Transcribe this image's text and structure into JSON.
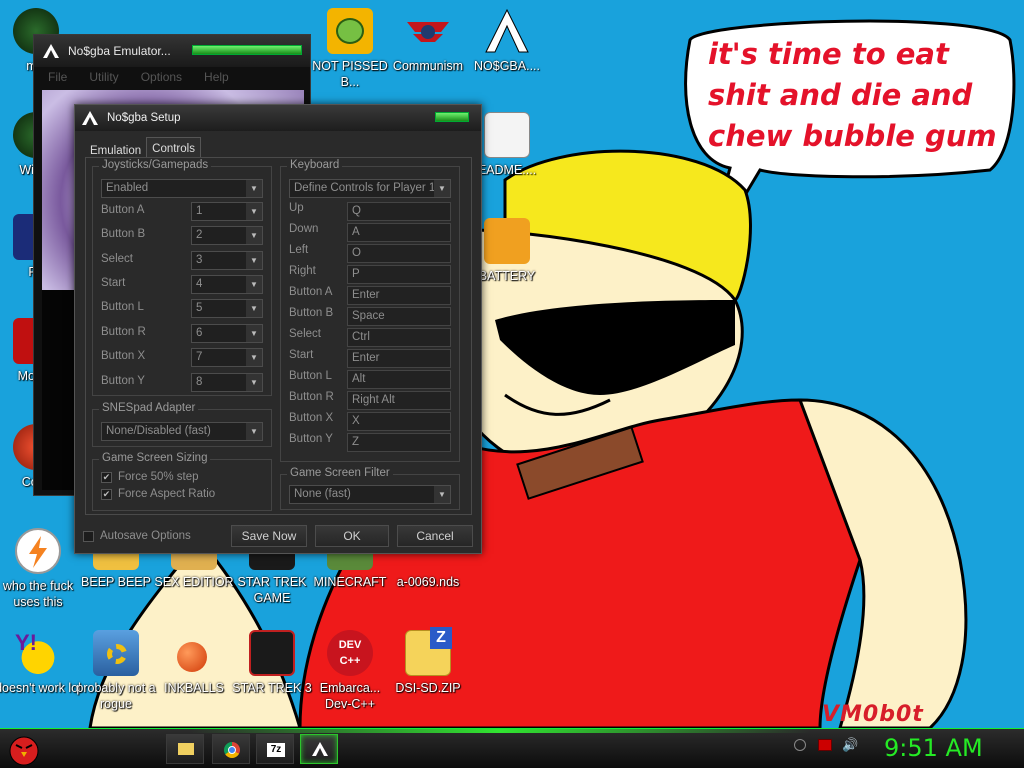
{
  "wallpaper": {
    "speech_text": "it's time to eat shit and die and chew bubble gum",
    "signature": "VM0b0t"
  },
  "desktop_icons": [
    {
      "label": "mix",
      "icon": "media-icon"
    },
    {
      "label": "Win V",
      "icon": "media-icon"
    },
    {
      "label": "Po",
      "icon": "photoshop-icon"
    },
    {
      "label": "Mo Re",
      "icon": "app-icon"
    },
    {
      "label": "Cock",
      "icon": "app-icon"
    },
    {
      "label": "NOT PISSED B...",
      "icon": "angry-birds-pig-icon"
    },
    {
      "label": "Communism",
      "icon": "communism-icon"
    },
    {
      "label": "NO$GBA....",
      "icon": "nogba-icon"
    },
    {
      "label": "EADME....",
      "icon": "document-icon"
    },
    {
      "label": "BATTERY",
      "icon": "folder-icon"
    },
    {
      "label": "who the fuck uses this",
      "icon": "winamp-icon"
    },
    {
      "label": "BEEP BEEP",
      "icon": "app-icon"
    },
    {
      "label": "SEX EDITIOR",
      "icon": "app-icon"
    },
    {
      "label": "STAR TREK GAME",
      "icon": "star-wars-icon"
    },
    {
      "label": "MINECRAFT",
      "icon": "minecraft-icon"
    },
    {
      "label": "a-0069.nds",
      "icon": "file-icon"
    },
    {
      "label": "doesn't work lol",
      "icon": "yahoo-messenger-icon"
    },
    {
      "label": "probably not a rogue",
      "icon": "gear-icon"
    },
    {
      "label": "INKBALLS",
      "icon": "inkball-icon"
    },
    {
      "label": "STAR TREK 3",
      "icon": "star-wars-icon"
    },
    {
      "label": "Embarca... Dev-C++",
      "icon": "dev-cpp-icon"
    },
    {
      "label": "DSI-SD.ZIP",
      "icon": "zip-folder-icon"
    }
  ],
  "emulator_window": {
    "title": "No$gba Emulator...",
    "menu": [
      "File",
      "Utility",
      "Options",
      "Help"
    ]
  },
  "setup_dialog": {
    "title": "No$gba Setup",
    "tabs": [
      "Emulation",
      "Controls"
    ],
    "active_tab": "Controls",
    "joysticks": {
      "group_title": "Joysticks/Gamepads",
      "mode": "Enabled",
      "buttons": [
        {
          "label": "Button A",
          "value": "1"
        },
        {
          "label": "Button B",
          "value": "2"
        },
        {
          "label": "Select",
          "value": "3"
        },
        {
          "label": "Start",
          "value": "4"
        },
        {
          "label": "Button L",
          "value": "5"
        },
        {
          "label": "Button R",
          "value": "6"
        },
        {
          "label": "Button X",
          "value": "7"
        },
        {
          "label": "Button Y",
          "value": "8"
        }
      ]
    },
    "snespad": {
      "group_title": "SNESpad Adapter",
      "value": "None/Disabled (fast)"
    },
    "sizing": {
      "group_title": "Game Screen Sizing",
      "options": [
        {
          "label": "Force 50% step",
          "checked": true
        },
        {
          "label": "Force Aspect Ratio",
          "checked": true
        }
      ]
    },
    "keyboard": {
      "group_title": "Keyboard",
      "player_select": "Define Controls for Player  1",
      "keys": [
        {
          "label": "Up",
          "value": "Q"
        },
        {
          "label": "Down",
          "value": "A"
        },
        {
          "label": "Left",
          "value": "O"
        },
        {
          "label": "Right",
          "value": "P"
        },
        {
          "label": "Button A",
          "value": "Enter"
        },
        {
          "label": "Button B",
          "value": "Space"
        },
        {
          "label": "Select",
          "value": "Ctrl"
        },
        {
          "label": "Start",
          "value": "Enter"
        },
        {
          "label": "Button L",
          "value": "Alt"
        },
        {
          "label": "Button R",
          "value": "Right Alt"
        },
        {
          "label": "Button X",
          "value": "X"
        },
        {
          "label": "Button Y",
          "value": "Z"
        }
      ]
    },
    "filter": {
      "group_title": "Game Screen Filter",
      "value": "None (fast)"
    },
    "footer": {
      "autosave_label": "Autosave Options",
      "save_now": "Save Now",
      "ok": "OK",
      "cancel": "Cancel"
    }
  },
  "taskbar": {
    "clock": "9:51 AM",
    "accent": "#25ea25"
  }
}
